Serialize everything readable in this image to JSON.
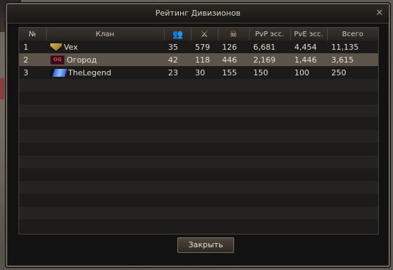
{
  "window": {
    "title": "Рейтинг Дивизионов",
    "close_label": "✕"
  },
  "table": {
    "headers": {
      "rank": "№",
      "clan": "Клан",
      "members_icon": "members-icon",
      "battles_icon": "crossed-swords-icon",
      "kills_icon": "skull-icon",
      "pvp": "PvP эсс.",
      "pve": "PvE эсс.",
      "total": "Всего"
    },
    "rows": [
      {
        "rank": "1",
        "clan": "Vex",
        "crest": "vex-crest-icon",
        "members": "35",
        "battles": "579",
        "kills": "126",
        "pvp": "6,681",
        "pve": "4,454",
        "total": "11,135"
      },
      {
        "rank": "2",
        "clan": "Огород",
        "crest": "og-crest-icon",
        "crest_text": "OG",
        "members": "42",
        "battles": "118",
        "kills": "446",
        "pvp": "2,169",
        "pve": "1,446",
        "total": "3,615"
      },
      {
        "rank": "3",
        "clan": "TheLegend",
        "crest": "legend-crest-icon",
        "members": "23",
        "battles": "30",
        "kills": "155",
        "pvp": "150",
        "pve": "100",
        "total": "250"
      }
    ]
  },
  "footer": {
    "close_button": "Закрыть"
  },
  "colors": {
    "selected_row": "#5c5349",
    "frame": "#6e6252",
    "panel": "#1a1917"
  }
}
